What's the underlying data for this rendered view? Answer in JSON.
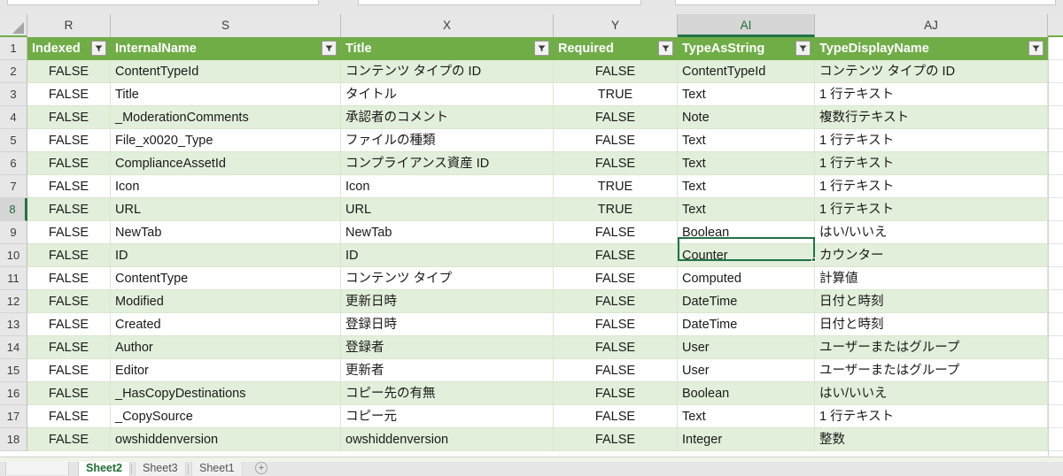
{
  "app": {
    "type": "spreadsheet"
  },
  "colors": {
    "header_green": "#70ad47",
    "band_green": "#e2efda",
    "active_border": "#217346",
    "header_strip": "#e7e7e7"
  },
  "columns": {
    "letters": [
      "R",
      "S",
      "X",
      "Y",
      "AI",
      "AJ"
    ],
    "selected_letter": "AI"
  },
  "rows": {
    "numbers": [
      "1",
      "2",
      "3",
      "4",
      "5",
      "6",
      "7",
      "8",
      "9",
      "10",
      "11",
      "12",
      "13",
      "14",
      "15",
      "16",
      "17",
      "18"
    ],
    "selected_number": "8"
  },
  "table": {
    "headers": [
      "Indexed",
      "InternalName",
      "Title",
      "Required",
      "TypeAsString",
      "TypeDisplayName"
    ],
    "rows": [
      [
        "FALSE",
        "ContentTypeId",
        "コンテンツ タイプの ID",
        "FALSE",
        "ContentTypeId",
        "コンテンツ タイプの ID"
      ],
      [
        "FALSE",
        "Title",
        "タイトル",
        "TRUE",
        "Text",
        "1 行テキスト"
      ],
      [
        "FALSE",
        "_ModerationComments",
        "承認者のコメント",
        "FALSE",
        "Note",
        "複数行テキスト"
      ],
      [
        "FALSE",
        "File_x0020_Type",
        "ファイルの種類",
        "FALSE",
        "Text",
        "1 行テキスト"
      ],
      [
        "FALSE",
        "ComplianceAssetId",
        "コンプライアンス資産 ID",
        "FALSE",
        "Text",
        "1 行テキスト"
      ],
      [
        "FALSE",
        "Icon",
        "Icon",
        "TRUE",
        "Text",
        "1 行テキスト"
      ],
      [
        "FALSE",
        "URL",
        "URL",
        "TRUE",
        "Text",
        "1 行テキスト"
      ],
      [
        "FALSE",
        "NewTab",
        "NewTab",
        "FALSE",
        "Boolean",
        "はい/いいえ"
      ],
      [
        "FALSE",
        "ID",
        "ID",
        "FALSE",
        "Counter",
        "カウンター"
      ],
      [
        "FALSE",
        "ContentType",
        "コンテンツ タイプ",
        "FALSE",
        "Computed",
        "計算値"
      ],
      [
        "FALSE",
        "Modified",
        "更新日時",
        "FALSE",
        "DateTime",
        "日付と時刻"
      ],
      [
        "FALSE",
        "Created",
        "登録日時",
        "FALSE",
        "DateTime",
        "日付と時刻"
      ],
      [
        "FALSE",
        "Author",
        "登録者",
        "FALSE",
        "User",
        "ユーザーまたはグループ"
      ],
      [
        "FALSE",
        "Editor",
        "更新者",
        "FALSE",
        "User",
        "ユーザーまたはグループ"
      ],
      [
        "FALSE",
        "_HasCopyDestinations",
        "コピー先の有無",
        "FALSE",
        "Boolean",
        "はい/いいえ"
      ],
      [
        "FALSE",
        "_CopySource",
        "コピー元",
        "FALSE",
        "Text",
        "1 行テキスト"
      ],
      [
        "FALSE",
        "owshiddenversion",
        "owshiddenversion",
        "FALSE",
        "Integer",
        "整数"
      ]
    ]
  },
  "active_cell": {
    "reference": "AI8",
    "value": "Text"
  },
  "sheet_tabs": {
    "tabs": [
      {
        "label": "Sheet2",
        "active": true
      },
      {
        "label": "Sheet3",
        "active": false
      },
      {
        "label": "Sheet1",
        "active": false
      }
    ],
    "add_label": "+"
  }
}
